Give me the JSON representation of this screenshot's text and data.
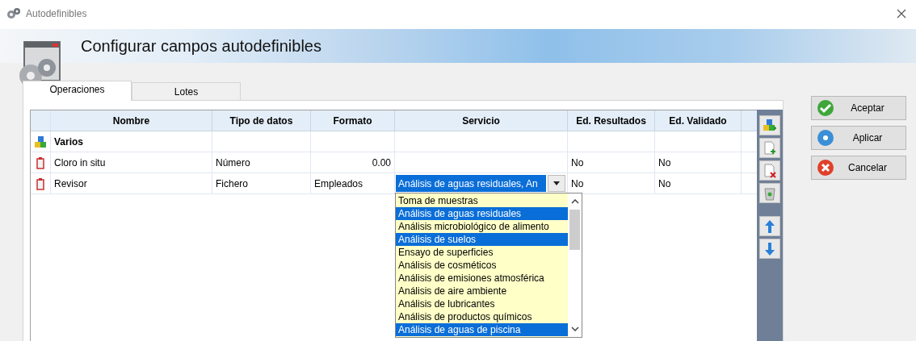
{
  "window": {
    "title": "Autodefinibles"
  },
  "header": {
    "title": "Configurar campos autodefinibles"
  },
  "tabs": [
    {
      "label": "Operaciones",
      "selected": true
    },
    {
      "label": "Lotes",
      "selected": false
    }
  ],
  "table": {
    "columns": [
      "Nombre",
      "Tipo de datos",
      "Formato",
      "Servicio",
      "Ed. Resultados",
      "Ed. Validado"
    ],
    "rows": [
      {
        "kind": "group",
        "name": "Varios"
      },
      {
        "kind": "field",
        "cells": [
          {
            "kind": "text",
            "text": "Cloro in situ"
          },
          {
            "kind": "text",
            "text": "Número"
          },
          {
            "kind": "number",
            "text": "0.00"
          },
          {
            "kind": "empty"
          },
          {
            "kind": "text",
            "text": "No"
          },
          {
            "kind": "text",
            "text": "No"
          }
        ]
      },
      {
        "kind": "field",
        "cells": [
          {
            "kind": "text",
            "text": "Revisor"
          },
          {
            "kind": "text",
            "text": "Fichero"
          },
          {
            "kind": "text",
            "text": "Empleados"
          },
          {
            "kind": "combo",
            "value": "Análisis de aguas residuales, An",
            "options": [
              {
                "label": "Toma de muestras",
                "selected": false
              },
              {
                "label": "Análisis de aguas residuales",
                "selected": true
              },
              {
                "label": "Análisis microbiológico de alimento",
                "selected": false
              },
              {
                "label": "Análisis de suelos",
                "selected": true
              },
              {
                "label": "Ensayo de superficies",
                "selected": false
              },
              {
                "label": "Análisis de cosméticos",
                "selected": false
              },
              {
                "label": "Análisis de emisiones atmosférica",
                "selected": false
              },
              {
                "label": "Análisis de aire ambiente",
                "selected": false
              },
              {
                "label": "Análisis de lubricantes",
                "selected": false
              },
              {
                "label": "Análisis de productos químicos",
                "selected": false
              },
              {
                "label": "Análisis de aguas de piscina",
                "selected": true
              }
            ]
          },
          {
            "kind": "text",
            "text": "No"
          },
          {
            "kind": "text",
            "text": "No"
          }
        ]
      }
    ]
  },
  "buttons": [
    {
      "kind": "ok",
      "label": "Aceptar"
    },
    {
      "kind": "apply",
      "label": "Aplicar"
    },
    {
      "kind": "cancel",
      "label": "Cancelar"
    }
  ]
}
